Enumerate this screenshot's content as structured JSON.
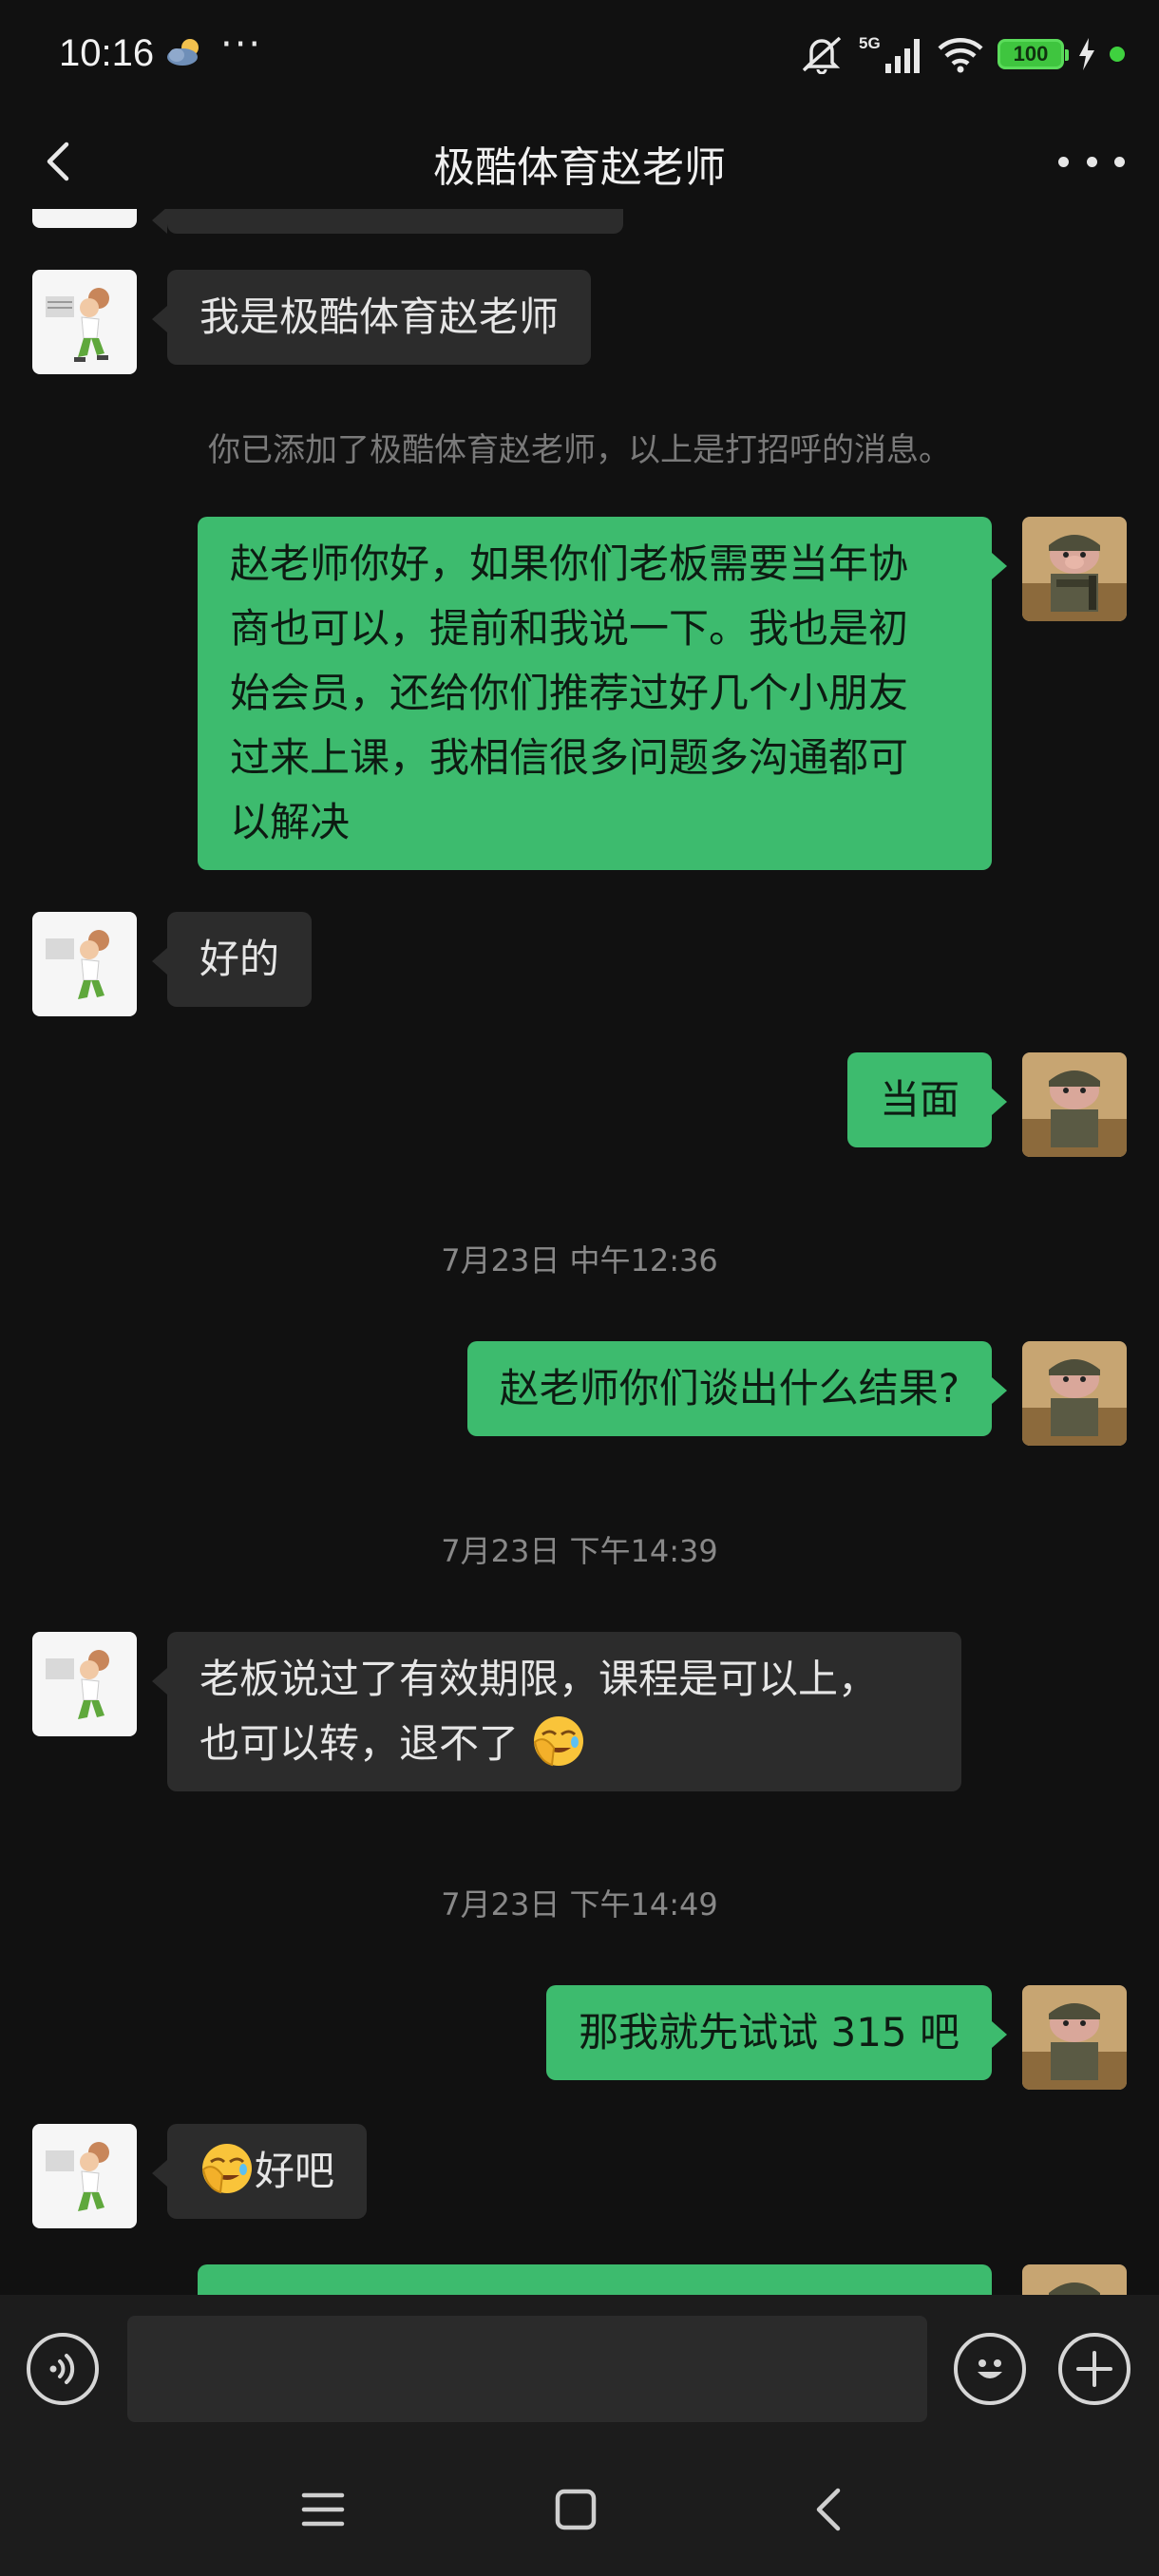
{
  "status_bar": {
    "time": "10:16",
    "dots": "···",
    "network": "5G",
    "battery": "100",
    "icons": [
      "weather-icon",
      "mute-icon",
      "signal-icon",
      "wifi-icon",
      "battery-icon",
      "charging-icon"
    ]
  },
  "header": {
    "title": "极酷体育赵老师",
    "back_icon": "chevron-left-icon",
    "more_icon": "more-dots-icon"
  },
  "messages": [
    {
      "type": "incoming",
      "text": "我是极酷体育赵老师"
    },
    {
      "type": "system",
      "text": "你已添加了极酷体育赵老师，以上是打招呼的消息。"
    },
    {
      "type": "outgoing",
      "lines": [
        "赵老师你好，如果你们老板需要当年协",
        "商也可以，提前和我说一下。我也是初",
        "始会员，还给你们推荐过好几个小朋友",
        "过来上课，我相信很多问题多沟通都可",
        "以解决"
      ]
    },
    {
      "type": "incoming",
      "text": "好的"
    },
    {
      "type": "outgoing",
      "text": "当面"
    },
    {
      "type": "timestamp",
      "text": "7月23日 中午12:36"
    },
    {
      "type": "outgoing",
      "text": "赵老师你们谈出什么结果?"
    },
    {
      "type": "timestamp",
      "text": "7月23日 下午14:39"
    },
    {
      "type": "incoming",
      "lines": [
        "老板说过了有效期限，课程是可以上，",
        "也可以转，退不了"
      ],
      "emoji": "facepalm-emoji"
    },
    {
      "type": "timestamp",
      "text": "7月23日 下午14:49"
    },
    {
      "type": "outgoing",
      "text": "那我就先试试 315 吧"
    },
    {
      "type": "incoming",
      "text": "好吧",
      "emoji": "facepalm-emoji"
    }
  ],
  "input_bar": {
    "voice_icon": "voice-icon",
    "emoji_icon": "smiley-icon",
    "plus_icon": "plus-icon",
    "value": ""
  },
  "nav_bar": {
    "icons": [
      "menu-icon",
      "home-icon",
      "back-icon"
    ]
  },
  "colors": {
    "background": "#111111",
    "incoming_bubble": "#2c2c2c",
    "outgoing_bubble": "#3dbb6e",
    "battery": "#3fc53f"
  }
}
